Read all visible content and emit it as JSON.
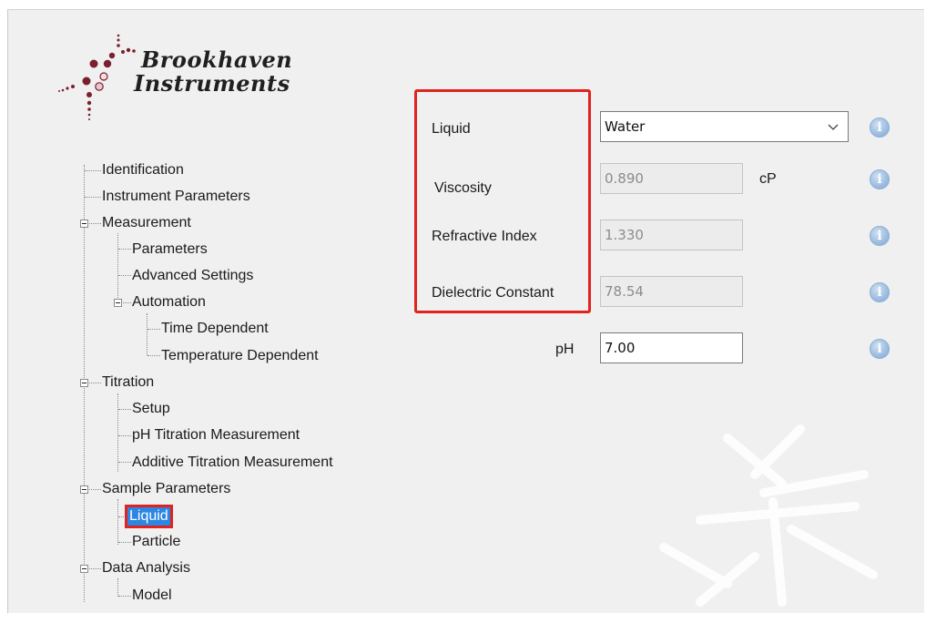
{
  "logo": {
    "line1": "Brookhaven",
    "line2": "Instruments"
  },
  "tree": [
    {
      "id": "identification",
      "label": "Identification"
    },
    {
      "id": "instrument-parameters",
      "label": "Instrument Parameters"
    },
    {
      "id": "measurement",
      "label": "Measurement"
    },
    {
      "id": "measurement-parameters",
      "label": "Parameters"
    },
    {
      "id": "advanced-settings",
      "label": "Advanced Settings"
    },
    {
      "id": "automation",
      "label": "Automation"
    },
    {
      "id": "time-dependent",
      "label": "Time Dependent"
    },
    {
      "id": "temperature-dependent",
      "label": "Temperature Dependent"
    },
    {
      "id": "titration",
      "label": "Titration"
    },
    {
      "id": "setup",
      "label": "Setup"
    },
    {
      "id": "ph-titration-measurement",
      "label": "pH Titration Measurement"
    },
    {
      "id": "additive-titration-measurement",
      "label": "Additive Titration Measurement"
    },
    {
      "id": "sample-parameters",
      "label": "Sample Parameters"
    },
    {
      "id": "liquid",
      "label": "Liquid",
      "selected": true
    },
    {
      "id": "particle",
      "label": "Particle"
    },
    {
      "id": "data-analysis",
      "label": "Data Analysis"
    },
    {
      "id": "model",
      "label": "Model"
    }
  ],
  "form": {
    "liquid_label": "Liquid",
    "liquid_value": "Water",
    "viscosity_label": "Viscosity",
    "viscosity_value": "0.890",
    "viscosity_unit": "cP",
    "refractive_index_label": "Refractive Index",
    "refractive_index_value": "1.330",
    "dielectric_constant_label": "Dielectric Constant",
    "dielectric_constant_value": "78.54",
    "ph_label": "pH",
    "ph_value": "7.00"
  },
  "icons": {
    "info": "info-icon",
    "expander": "minus-box-icon",
    "dropdown": "chevron-down-icon"
  },
  "colors": {
    "highlight_box": "#e0231e",
    "selection": "#2b86e4",
    "panel": "#f0f0f0",
    "info_icon": "#9dbde0"
  }
}
